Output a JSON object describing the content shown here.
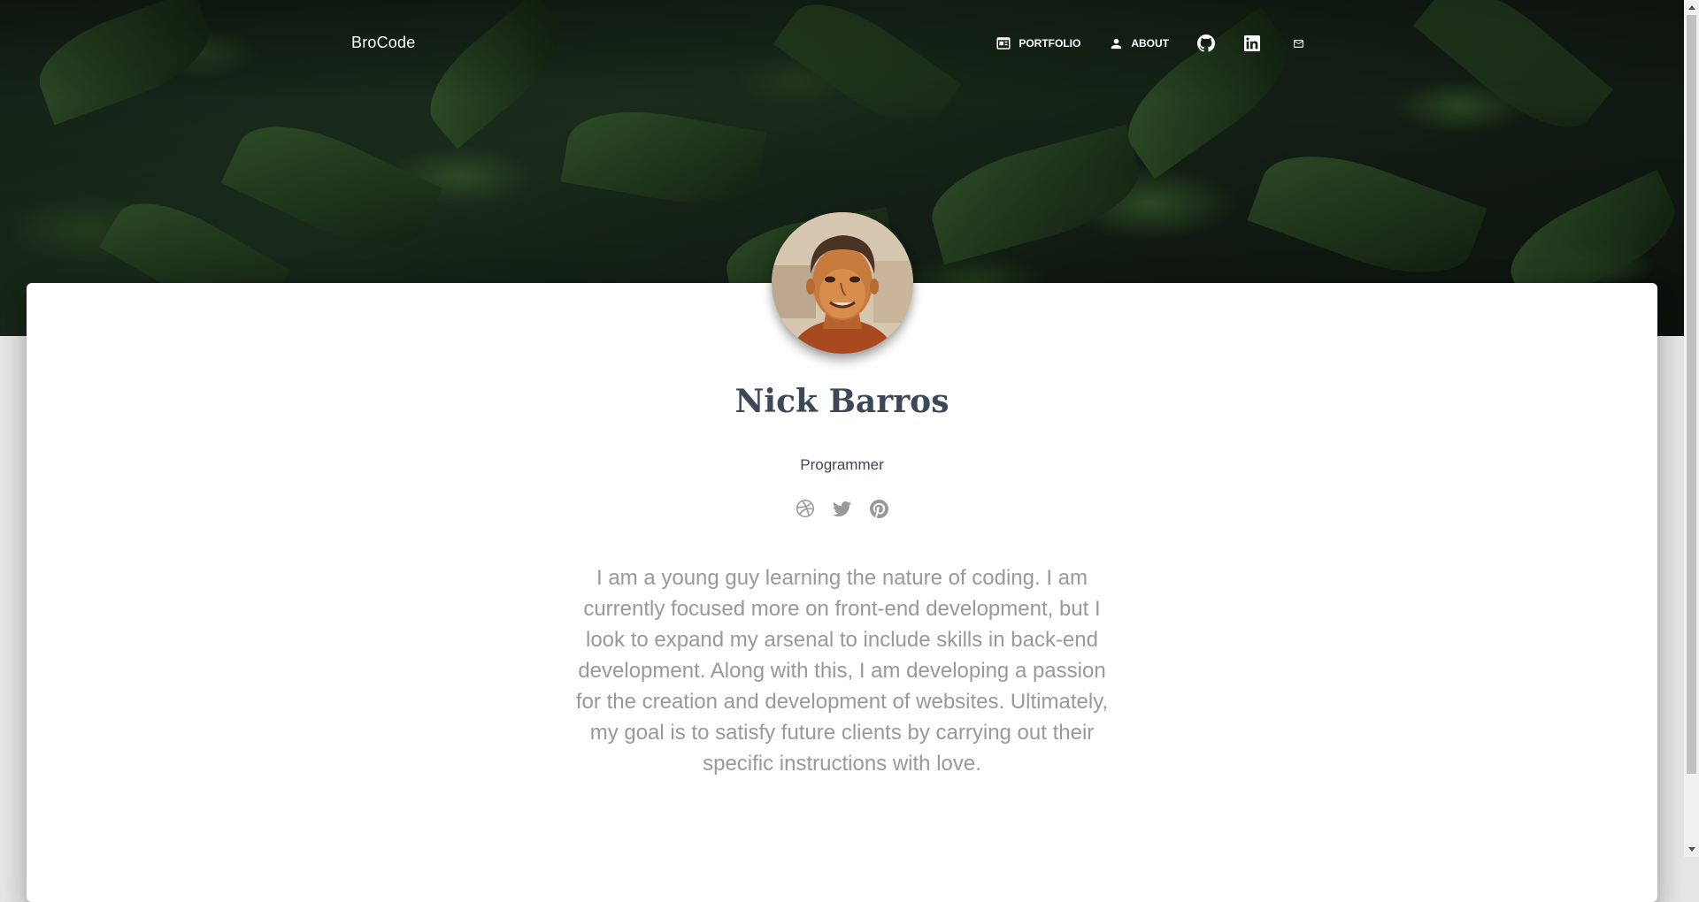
{
  "navbar": {
    "brand": "BroCode",
    "links": [
      {
        "label": "PORTFOLIO",
        "icon": "dashboard-icon"
      },
      {
        "label": "ABOUT",
        "icon": "person-icon"
      }
    ],
    "icon_links": [
      "github-icon",
      "linkedin-icon",
      "mail-icon"
    ]
  },
  "profile": {
    "name": "Nick Barros",
    "role": "Programmer",
    "socials": [
      "dribbble-icon",
      "twitter-icon",
      "pinterest-icon"
    ],
    "bio": "I am a young guy learning the nature of coding. I am currently focused more on front-end development, but I look to expand my arsenal to include skills in back-end development. Along with this, I am developing a passion for the creation and development of websites. Ultimately, my goal is to satisfy future clients by carrying out their specific instructions with love."
  },
  "colors": {
    "title": "#3c4858",
    "muted": "#999999",
    "card": "#ffffff",
    "page_bg": "#e5e5e5"
  }
}
